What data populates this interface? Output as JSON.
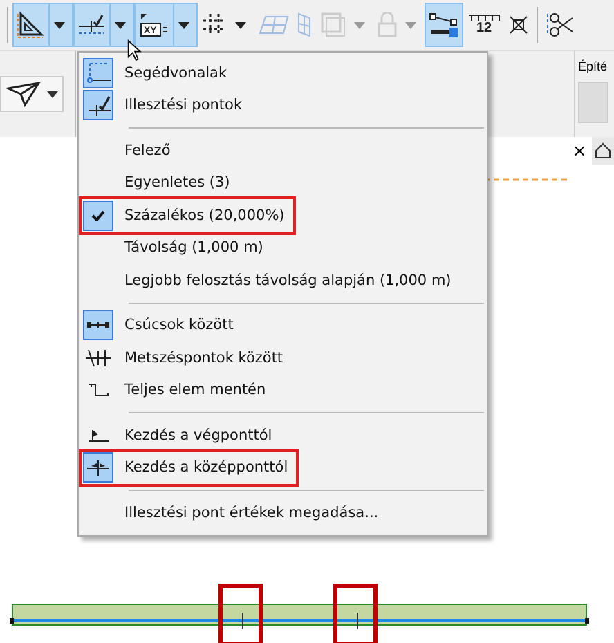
{
  "toolbar": [
    {
      "kind": "guide",
      "active": true,
      "dropdown": true,
      "disabled": false
    },
    {
      "kind": "snap",
      "active": true,
      "dropdown": true,
      "disabled": false
    },
    {
      "kind": "coords",
      "active": true,
      "dropdown": true,
      "disabled": false,
      "label": "XY"
    },
    {
      "kind": "grid",
      "active": false,
      "dropdown": true,
      "disabled": false
    },
    {
      "kind": "plane",
      "active": false,
      "dropdown": false,
      "disabled": true
    },
    {
      "kind": "plane2",
      "active": false,
      "dropdown": false,
      "disabled": true
    },
    {
      "kind": "frame",
      "active": false,
      "dropdown": true,
      "disabled": true
    },
    {
      "kind": "lock",
      "active": false,
      "dropdown": true,
      "disabled": true
    },
    {
      "kind": "select",
      "active": true,
      "dropdown": false,
      "disabled": false
    },
    {
      "kind": "ruler",
      "active": false,
      "dropdown": false,
      "disabled": false,
      "label": "12"
    },
    {
      "kind": "cross",
      "active": false,
      "dropdown": false,
      "disabled": false
    },
    {
      "kind": "scissors",
      "active": false,
      "dropdown": false,
      "disabled": false
    }
  ],
  "panel_label": "Építé",
  "tab_close": "×",
  "menu": {
    "sections": [
      [
        {
          "label": "Segédvonalak",
          "checked": true,
          "highlighted": false
        },
        {
          "label": "Illesztési pontok",
          "checked": true,
          "highlighted": false
        }
      ],
      [
        {
          "label": "Felező",
          "checked": false,
          "highlighted": false
        },
        {
          "label": "Egyenletes (3)",
          "checked": false,
          "highlighted": false
        },
        {
          "label": "Százalékos (20,000%)",
          "checked": true,
          "highlighted": true
        },
        {
          "label": "Távolság (1,000 m)",
          "checked": false,
          "highlighted": false
        },
        {
          "label": "Legjobb felosztás távolság alapján (1,000 m)",
          "checked": false,
          "highlighted": false
        }
      ],
      [
        {
          "label": "Csúcsok között",
          "checked": true,
          "highlighted": false
        },
        {
          "label": "Metszéspontok között",
          "checked": false,
          "highlighted": false
        },
        {
          "label": "Teljes elem mentén",
          "checked": false,
          "highlighted": false
        }
      ],
      [
        {
          "label": "Kezdés a végponttól",
          "checked": false,
          "highlighted": false
        },
        {
          "label": "Kezdés a középponttól",
          "checked": true,
          "highlighted": true
        }
      ],
      [
        {
          "label": "Illesztési pont értékek megadása...",
          "checked": false,
          "highlighted": false
        }
      ]
    ]
  },
  "beam": {
    "markers": [
      {
        "highlighted": true
      },
      {
        "highlighted": true
      }
    ]
  }
}
